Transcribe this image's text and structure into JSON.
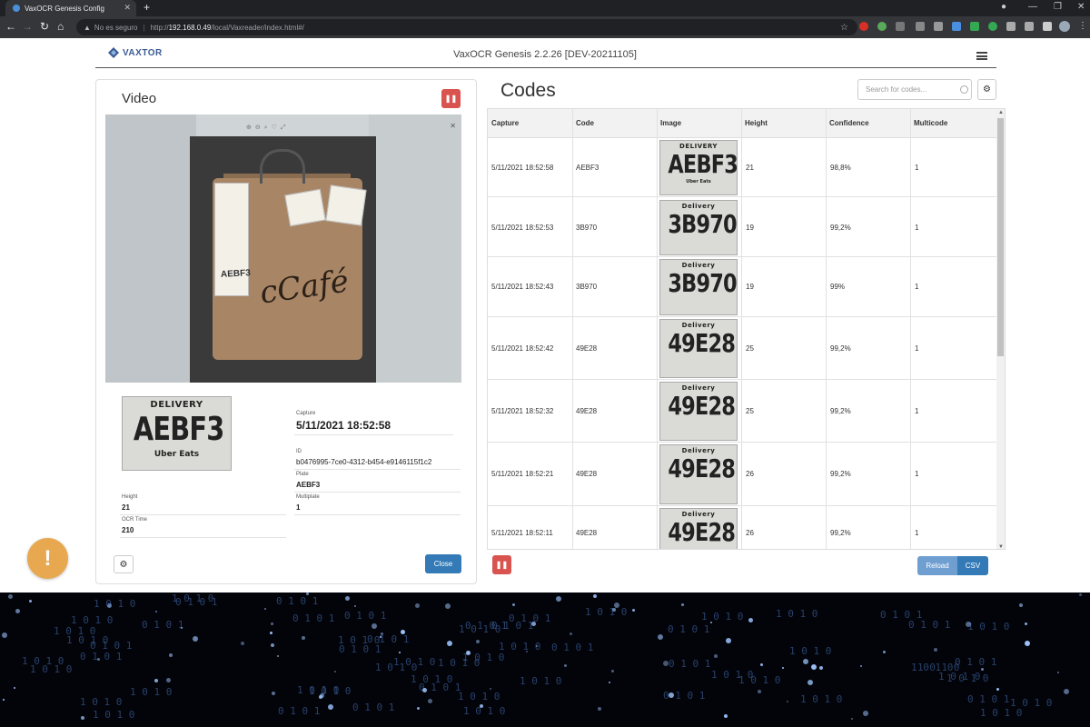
{
  "browser": {
    "tab_title": "VaxOCR Genesis Config",
    "security_label": "No es seguro",
    "url_prefix": "http://",
    "url_host": "192.168.0.49",
    "url_path": "/local/Vaxreader/index.html#/"
  },
  "header": {
    "logo_text": "VAXTOR",
    "app_title": "VaxOCR Genesis 2.2.26 [DEV-20211105]"
  },
  "video_panel": {
    "title": "Video",
    "plate_crop": {
      "top": "DELIVERY",
      "code": "AEBF3",
      "bottom": "Uber Eats"
    },
    "capture_label": "Capture",
    "capture_value": "5/11/2021 18:52:58",
    "id_label": "ID",
    "id_value": "b0476995-7ce0-4312-b454-e9146115f1c2",
    "plate_label": "Plate",
    "plate_value": "AEBF3",
    "height_label": "Height",
    "height_value": "21",
    "multiplate_label": "Multiplate",
    "multiplate_value": "1",
    "ocr_time_label": "OCR Time",
    "ocr_time_value": "210",
    "close_label": "Close"
  },
  "codes": {
    "title": "Codes",
    "search_placeholder": "Search for codes...",
    "columns": [
      "Capture",
      "Code",
      "Image",
      "Height",
      "Confidence",
      "Multicode"
    ],
    "rows": [
      {
        "capture": "5/11/2021 18:52:58",
        "code": "AEBF3",
        "img_top": "DELIVERY",
        "img_code": "AEBF3",
        "img_bottom": "Uber Eats",
        "height": "21",
        "confidence": "98,8%",
        "multicode": "1"
      },
      {
        "capture": "5/11/2021 18:52:53",
        "code": "3B970",
        "img_top": "Delivery",
        "img_code": "3B970",
        "img_bottom": "",
        "height": "19",
        "confidence": "99,2%",
        "multicode": "1"
      },
      {
        "capture": "5/11/2021 18:52:43",
        "code": "3B970",
        "img_top": "Delivery",
        "img_code": "3B970",
        "img_bottom": "",
        "height": "19",
        "confidence": "99%",
        "multicode": "1"
      },
      {
        "capture": "5/11/2021 18:52:42",
        "code": "49E28",
        "img_top": "Delivery",
        "img_code": "49E28",
        "img_bottom": "",
        "height": "25",
        "confidence": "99,2%",
        "multicode": "1"
      },
      {
        "capture": "5/11/2021 18:52:32",
        "code": "49E28",
        "img_top": "Delivery",
        "img_code": "49E28",
        "img_bottom": "",
        "height": "25",
        "confidence": "99,2%",
        "multicode": "1"
      },
      {
        "capture": "5/11/2021 18:52:21",
        "code": "49E28",
        "img_top": "Delivery",
        "img_code": "49E28",
        "img_bottom": "",
        "height": "26",
        "confidence": "99,2%",
        "multicode": "1"
      },
      {
        "capture": "5/11/2021 18:52:11",
        "code": "49E28",
        "img_top": "Delivery",
        "img_code": "49E28",
        "img_bottom": "",
        "height": "26",
        "confidence": "99,2%",
        "multicode": "1"
      }
    ],
    "reload_label": "Reload",
    "csv_label": "CSV"
  },
  "colors": {
    "primary": "#337ab7",
    "danger": "#d9534f",
    "warning": "#e8a84f",
    "logo": "#3a5a92"
  },
  "icons": {
    "pause": "pause-icon",
    "gear": "gear-icon",
    "alert": "exclamation-icon",
    "menu": "hamburger-icon"
  }
}
